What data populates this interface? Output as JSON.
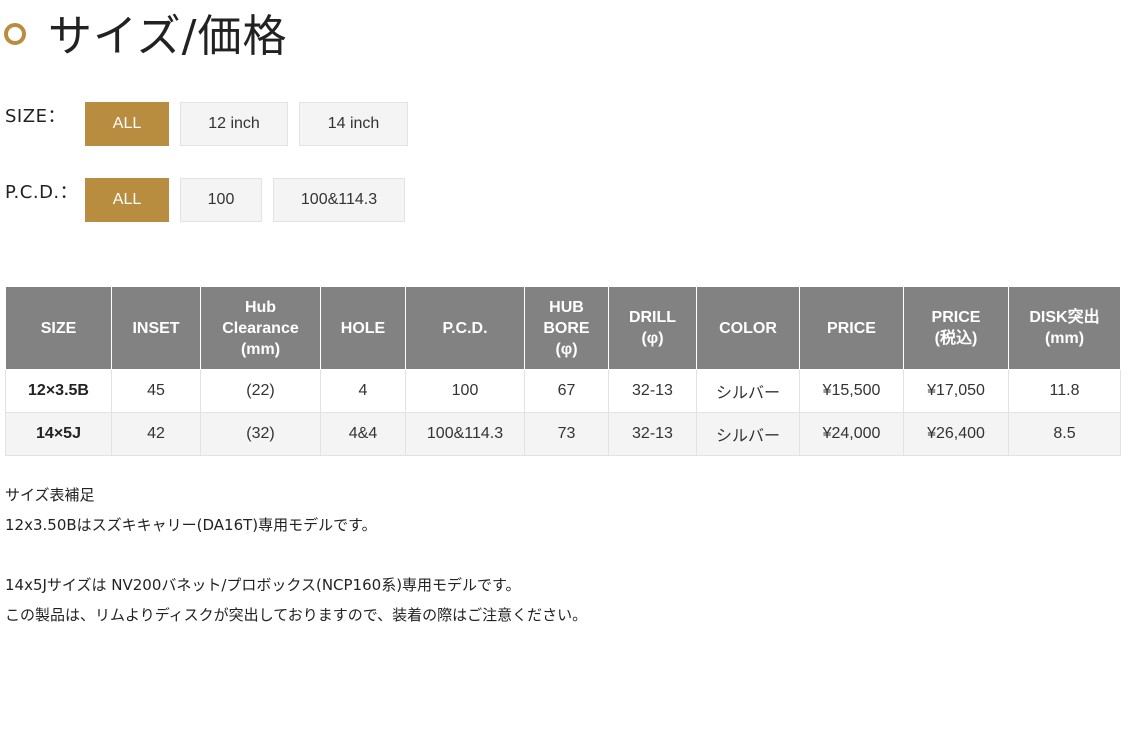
{
  "section_title": "サイズ/価格",
  "filters": {
    "size": {
      "label": "SIZE：",
      "options": [
        "ALL",
        "12 inch",
        "14 inch"
      ],
      "selected": "ALL"
    },
    "pcd": {
      "label": "P.C.D.：",
      "options": [
        "ALL",
        "100",
        "100&114.3"
      ],
      "selected": "ALL"
    }
  },
  "table": {
    "headers": [
      [
        "SIZE"
      ],
      [
        "INSET"
      ],
      [
        "Hub",
        "Clearance",
        "(mm)"
      ],
      [
        "HOLE"
      ],
      [
        "P.C.D."
      ],
      [
        "HUB",
        "BORE",
        "(φ)"
      ],
      [
        "DRILL",
        "(φ)"
      ],
      [
        "COLOR"
      ],
      [
        "PRICE"
      ],
      [
        "PRICE",
        "(税込)"
      ],
      [
        "DISK突出",
        "(mm)"
      ]
    ],
    "rows": [
      [
        "12×3.5B",
        "45",
        "(22)",
        "4",
        "100",
        "67",
        "32-13",
        "シルバー",
        "¥15,500",
        "¥17,050",
        "11.8"
      ],
      [
        "14×5J",
        "42",
        "(32)",
        "4&4",
        "100&114.3",
        "73",
        "32-13",
        "シルバー",
        "¥24,000",
        "¥26,400",
        "8.5"
      ]
    ]
  },
  "notes": [
    "サイズ表補足",
    "12x3.50Bはスズキキャリー(DA16T)専用モデルです。",
    "",
    "14x5Jサイズは NV200バネット/プロボックス(NCP160系)専用モデルです。",
    "この製品は、リムよりディスクが突出しておりますので、装着の際はご注意ください。"
  ],
  "colors": {
    "accent": "#b98d3f",
    "header_bg": "#828282",
    "chip_bg": "#f4f4f4"
  }
}
